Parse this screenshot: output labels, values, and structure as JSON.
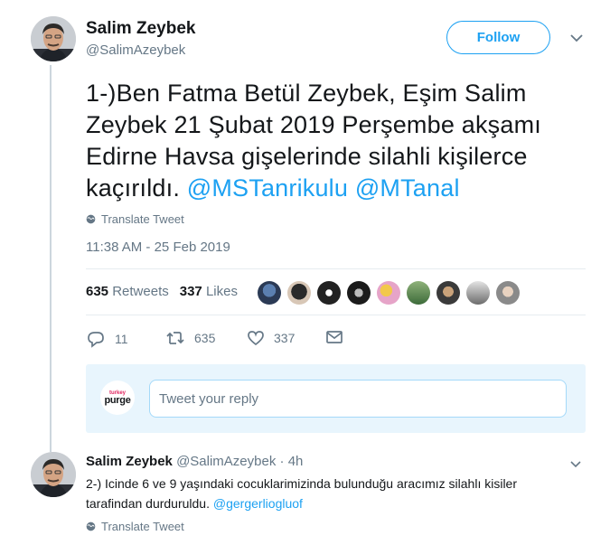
{
  "main_tweet": {
    "author_name": "Salim Zeybek",
    "author_handle": "@SalimAzeybek",
    "follow_label": "Follow",
    "text_part": "1-)Ben Fatma Betül Zeybek, Eşim Salim Zeybek 21 Şubat 2019 Perşembe akşamı Edirne Havsa gişelerinde silahli kişilerce kaçırıldı.",
    "mentions": [
      "@MSTanrikulu",
      "@MTanal"
    ],
    "translate_label": "Translate Tweet",
    "timestamp": "11:38 AM - 25 Feb 2019",
    "retweets_count": "635",
    "retweets_label": "Retweets",
    "likes_count": "337",
    "likes_label": "Likes",
    "actions": {
      "reply_count": "11",
      "retweet_count": "635",
      "like_count": "337"
    }
  },
  "reply_box": {
    "avatar_line1": "turkey",
    "avatar_line2": "purge",
    "placeholder": "Tweet your reply"
  },
  "reply_tweet": {
    "author_name": "Salim Zeybek",
    "author_handle": "@SalimAzeybek",
    "separator": "·",
    "age": "4h",
    "text": "2-) Icinde 6 ve 9 yaşındaki cocuklarimizinda bulunduğu aracımız silahlı kisiler tarafindan durduruldu.",
    "mention": "@gergerliogluof",
    "translate_label": "Translate Tweet"
  },
  "colors": {
    "accent": "#1da1f2",
    "muted": "#657786",
    "text": "#14171a",
    "divider": "#e6ecf0",
    "reply_box_bg": "#e8f5fd"
  },
  "icons": [
    "avatar",
    "chevron-down-icon",
    "globe-icon",
    "reply-icon",
    "retweet-icon",
    "heart-icon",
    "message-icon"
  ]
}
